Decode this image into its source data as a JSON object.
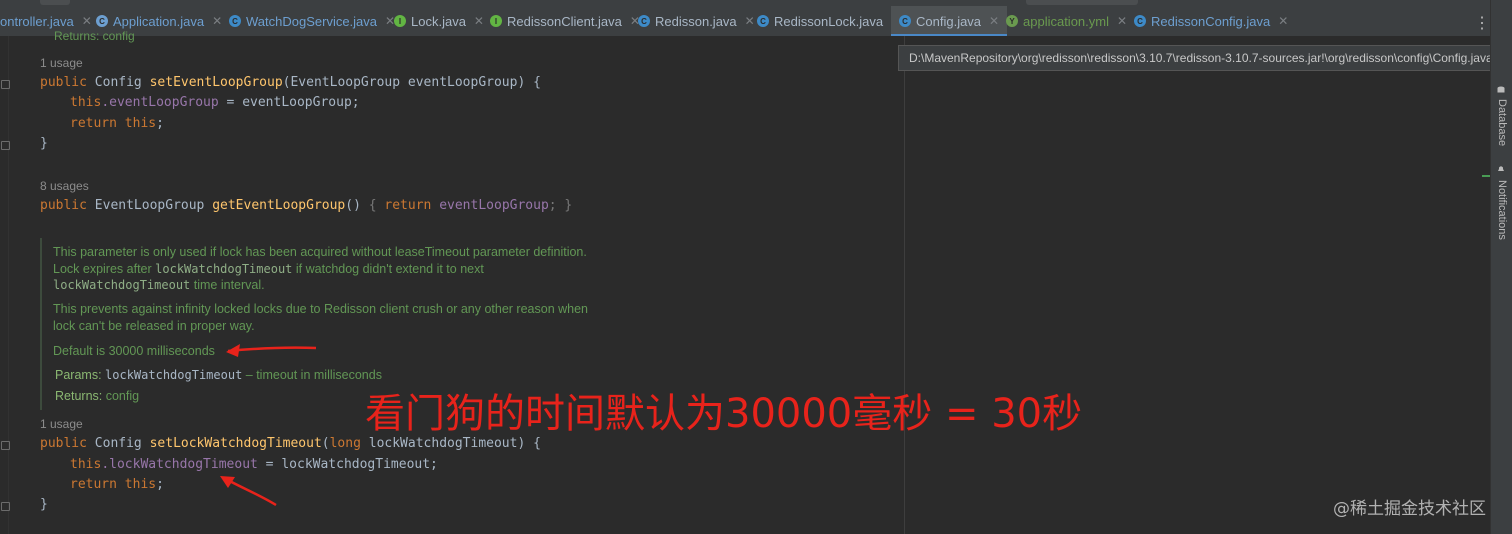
{
  "tabs": [
    {
      "name": "ontroller.java",
      "icon": "",
      "color": "blue"
    },
    {
      "name": "Application.java",
      "icon": "C",
      "color": "blue"
    },
    {
      "name": "WatchDogService.java",
      "icon": "C",
      "color": "blue"
    },
    {
      "name": "Lock.java",
      "icon": "I",
      "color": "plain"
    },
    {
      "name": "RedissonClient.java",
      "icon": "I",
      "color": "plain"
    },
    {
      "name": "Redisson.java",
      "icon": "C",
      "color": "plain"
    },
    {
      "name": "RedissonLock.java",
      "icon": "C",
      "color": "plain"
    },
    {
      "name": "Config.java",
      "icon": "C",
      "color": "plain"
    },
    {
      "name": "application.yml",
      "icon": "Y",
      "color": "green"
    },
    {
      "name": "RedissonConfig.java",
      "icon": "C",
      "color": "blue"
    }
  ],
  "tooltip": "D:\\MavenRepository\\org\\redisson\\redisson\\3.10.7\\redisson-3.10.7-sources.jar!\\org\\redisson\\config\\Config.java",
  "code": {
    "top_partial": "Returns: config",
    "usage_1": "1 usage",
    "set_event_loop": {
      "mod": "public",
      "type": "Config",
      "name": "setEventLoopGroup",
      "params": "(EventLoopGroup eventLoopGroup) {"
    },
    "body_this1": "this",
    "body_field1": ".eventLoopGroup",
    "body_rest1": " = eventLoopGroup;",
    "ret": "return",
    "this_kw": "this",
    "semi": ";",
    "close": "}",
    "usage_8": "8 usages",
    "get_event_loop": {
      "mod": "public",
      "type": "EventLoopGroup",
      "name": "getEventLoopGroup",
      "parens": "()",
      "inline_open": "{",
      "ret": "return",
      "field": "eventLoopGroup",
      "inline_close": "; }"
    },
    "usage_1b": "1 usage",
    "set_lock": {
      "mod": "public",
      "type": "Config",
      "name": "setLockWatchdogTimeout",
      "params_open": "(",
      "long": "long",
      "params_rest": " lockWatchdogTimeout) {"
    },
    "body_field2": ".lockWatchdogTimeout",
    "body_rest2": " = lockWatchdogTimeout;"
  },
  "doc": {
    "p1a": "This parameter is only used if lock has been acquired without leaseTimeout parameter definition.",
    "p1b_pre": "Lock expires after ",
    "p1b_code": "lockWatchdogTimeout",
    "p1b_post": " if watchdog didn't extend it to next",
    "p1c_code": "lockWatchdogTimeout",
    "p1c_post": " time interval.",
    "p2a": "This prevents against infinity locked locks due to Redisson client crush or any other reason when",
    "p2b": "lock can't be released in proper way.",
    "p3": "Default is 30000 milliseconds",
    "params_label": "Params:",
    "params_name": "lockWatchdogTimeout",
    "params_desc": " – timeout in milliseconds",
    "returns_label": "Returns:",
    "returns_val": " config"
  },
  "annotation": "看门狗的时间默认为30000毫秒 = 30秒",
  "watermark": "@稀土掘金技术社区",
  "right_panel": {
    "database": "Database",
    "notifications": "Notifications"
  },
  "colors": {
    "annotation": "#e8231b",
    "keyword": "#cc7832",
    "method": "#ffc66d",
    "field": "#9876aa",
    "doc": "#629755",
    "active_tab_underline": "#4a88c7"
  }
}
